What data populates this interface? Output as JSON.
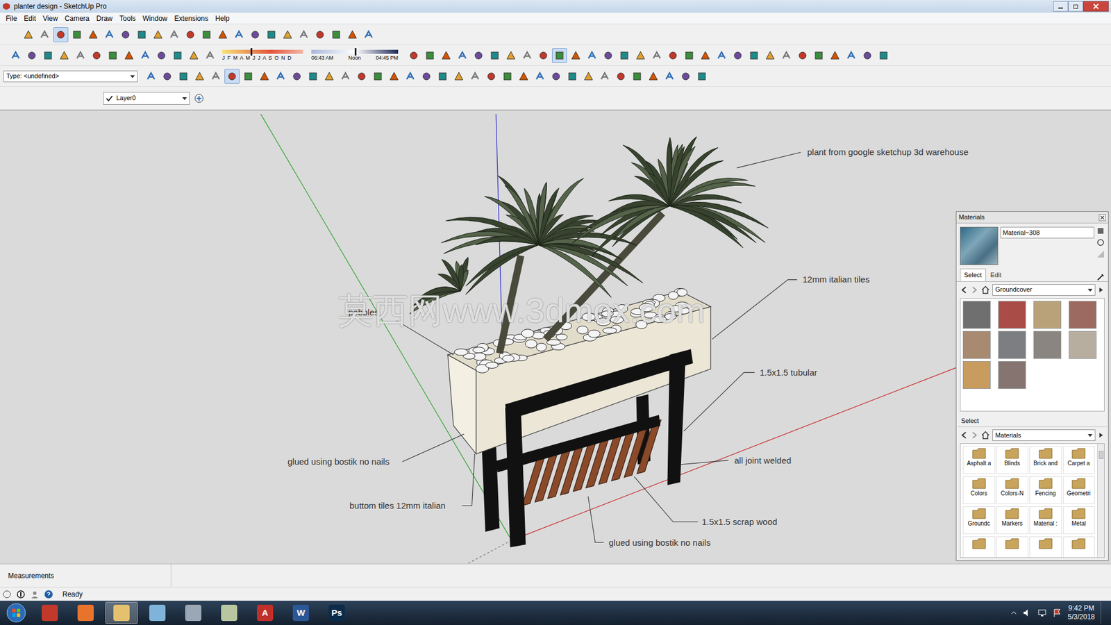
{
  "window": {
    "title": "planter design - SketchUp Pro"
  },
  "menu": [
    "File",
    "Edit",
    "View",
    "Camera",
    "Draw",
    "Tools",
    "Window",
    "Extensions",
    "Help"
  ],
  "toolbar_rows": [
    {
      "icons": 22,
      "selected": 2
    },
    {
      "icons": 43,
      "selected": 22
    },
    {
      "icons": 35,
      "selected": 5
    }
  ],
  "shadow": {
    "months": "J F M A M J J A S O N D",
    "date_level": 0.35,
    "times": [
      "06:43 AM",
      "Noon",
      "04:45 PM"
    ],
    "time_level": 0.5
  },
  "type_field": {
    "value": "Type: <undefined>"
  },
  "layer": {
    "name": "Layer0",
    "current": true
  },
  "labels": [
    "plant from google sketchup 3d warehouse",
    "12mm italian tiles",
    "pebbles",
    "1.5x1.5 tubular",
    "glued using bostik no nails",
    "all joint welded",
    "buttom tiles 12mm italian",
    "1.5x1.5 scrap wood",
    "glued using bostik no nails"
  ],
  "watermark": "莫西网www.3dmox.com",
  "materials": {
    "title": "Materials",
    "name": "Material~308",
    "tabs": [
      {
        "label": "Select",
        "selected": true
      },
      {
        "label": "Edit",
        "selected": false
      }
    ],
    "library": "Groundcover",
    "swatches": [
      {
        "color": "#6f6f6f"
      },
      {
        "color": "#a94c48"
      },
      {
        "color": "#b9a27a"
      },
      {
        "color": "#9c6a60"
      },
      {
        "color": "#a88a70"
      },
      {
        "color": "#7c7e82"
      },
      {
        "color": "#8a8580"
      },
      {
        "color": "#b8aea0"
      },
      {
        "color": "#c89c5e"
      },
      {
        "color": "#857470"
      }
    ],
    "secondary_label": "Select",
    "secondary_library": "Materials",
    "folders": [
      {
        "label": "Asphalt a"
      },
      {
        "label": "Blinds"
      },
      {
        "label": "Brick and"
      },
      {
        "label": "Carpet a"
      },
      {
        "label": "Colors"
      },
      {
        "label": "Colors-N"
      },
      {
        "label": "Fencing"
      },
      {
        "label": "Geometri"
      },
      {
        "label": "Groundc"
      },
      {
        "label": "Markers"
      },
      {
        "label": "Material :"
      },
      {
        "label": "Metal"
      },
      {
        "label": ""
      },
      {
        "label": ""
      },
      {
        "label": ""
      },
      {
        "label": ""
      }
    ]
  },
  "measurements": {
    "label": "Measurements"
  },
  "status": "Ready",
  "taskbar": {
    "apps": [
      {
        "label": "",
        "color": "#c0392b",
        "active": false
      },
      {
        "label": "",
        "color": "#e8742c",
        "active": false
      },
      {
        "label": "",
        "color": "#e3c16f",
        "active": true
      },
      {
        "label": "",
        "color": "#7fb3d9",
        "active": false
      },
      {
        "label": "",
        "color": "#9aa7b4",
        "active": false
      },
      {
        "label": "",
        "color": "#b9c7a0",
        "active": false
      },
      {
        "label": "A",
        "color": "#c0302a",
        "active": false
      },
      {
        "label": "W",
        "color": "#2b5797",
        "active": false
      },
      {
        "label": "Ps",
        "color": "#0b2b4a",
        "active": false
      }
    ],
    "time": "9:42 PM",
    "date": "5/3/2018"
  }
}
